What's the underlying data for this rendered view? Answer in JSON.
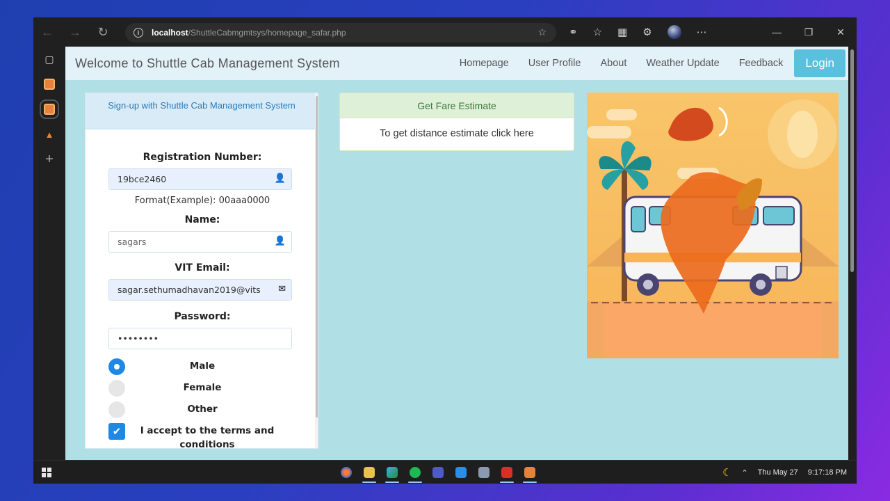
{
  "browser": {
    "url_host": "localhost",
    "url_path": "/ShuttleCabmgmtsys/homepage_safar.php"
  },
  "navbar": {
    "brand": "Welcome to Shuttle Cab Management System",
    "links": [
      "Homepage",
      "User Profile",
      "About",
      "Weather Update",
      "Feedback"
    ],
    "login": "Login"
  },
  "signup": {
    "heading": "Sign-up with Shuttle Cab Management System",
    "registration_label": "Registration Number:",
    "registration_value": "19bce2460",
    "registration_hint": "Format(Example): 00aaa0000",
    "name_label": "Name:",
    "name_value": "sagars",
    "email_label": "VIT Email:",
    "email_value": "sagar.sethumadhavan2019@vits",
    "password_label": "Password:",
    "password_value": "••••••••",
    "gender_options": [
      "Male",
      "Female",
      "Other"
    ],
    "gender_selected": "Male",
    "terms_label": "I accept to the terms and conditions",
    "terms_checked": true
  },
  "fare": {
    "heading": "Get Fare Estimate",
    "body": "To get distance estimate click here"
  },
  "taskbar": {
    "date": "Thu May 27",
    "time": "9:17:18 PM"
  },
  "colors": {
    "page_bg": "#b0dfe5",
    "navbar_bg": "#e3f1f9",
    "login_bg": "#5bc0de",
    "accent_blue": "#1e88e5",
    "fare_head_bg": "#dff0d8"
  }
}
